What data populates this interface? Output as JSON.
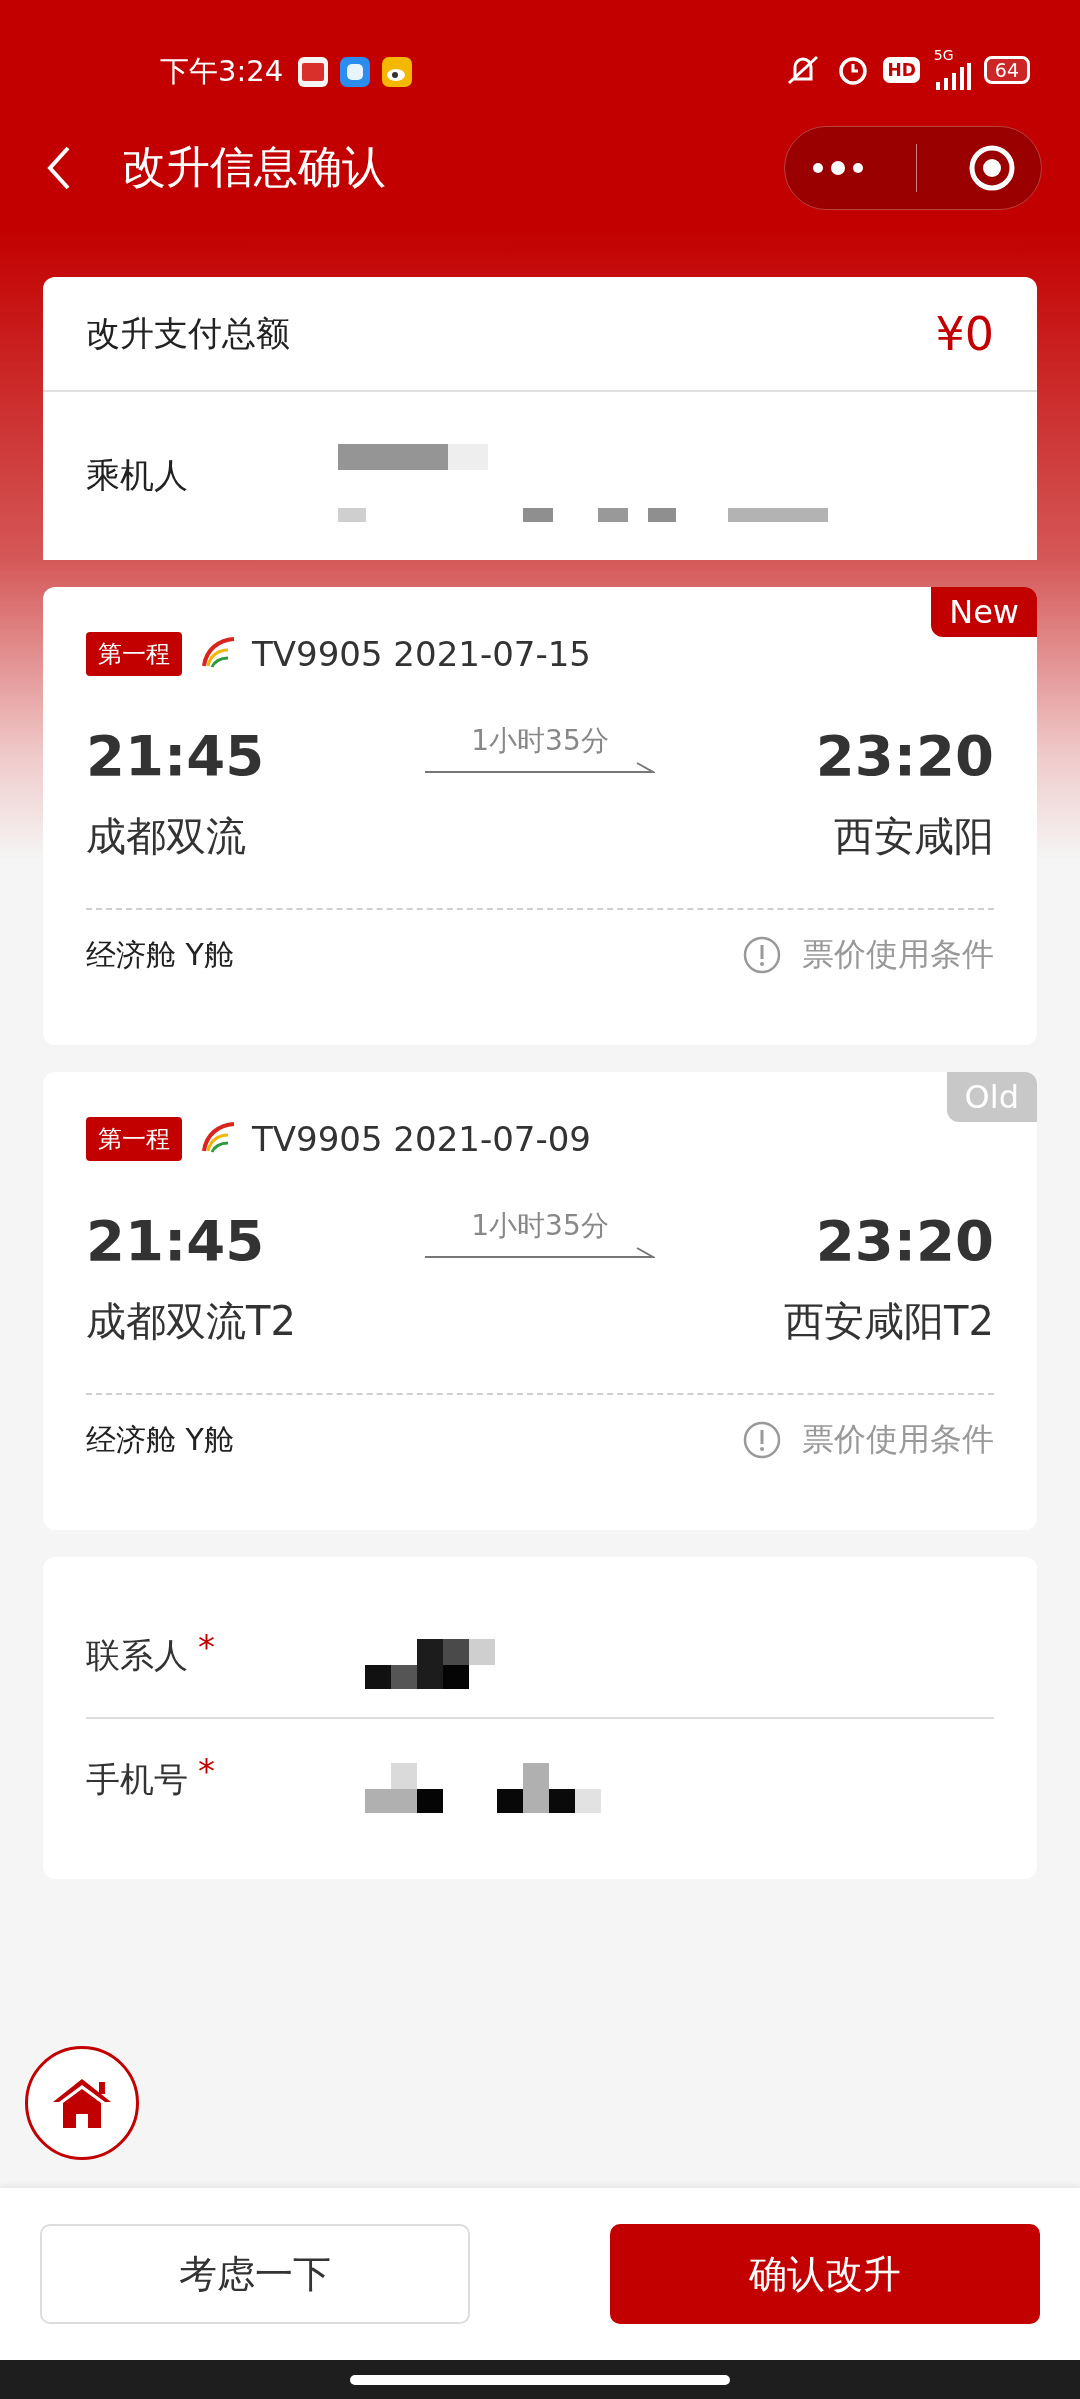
{
  "status_bar": {
    "time": "下午3:24",
    "hd": "HD",
    "network": "5G",
    "battery": "64"
  },
  "header": {
    "title": "改升信息确认"
  },
  "payment": {
    "label": "改升支付总额",
    "amount": "¥0"
  },
  "passenger": {
    "label": "乘机人"
  },
  "flights": [
    {
      "kind": "new",
      "tag": "New",
      "segment": "第一程",
      "flight": "TV9905 2021-07-15",
      "dep_time": "21:45",
      "duration": "1小时35分",
      "arr_time": "23:20",
      "dep_airport": "成都双流",
      "arr_airport": "西安咸阳",
      "cabin": "经济舱 Y舱",
      "rules": "票价使用条件"
    },
    {
      "kind": "old",
      "tag": "Old",
      "segment": "第一程",
      "flight": "TV9905 2021-07-09",
      "dep_time": "21:45",
      "duration": "1小时35分",
      "arr_time": "23:20",
      "dep_airport": "成都双流T2",
      "arr_airport": "西安咸阳T2",
      "cabin": "经济舱 Y舱",
      "rules": "票价使用条件"
    }
  ],
  "contact": [
    {
      "label": "联系人",
      "required": "*"
    },
    {
      "label": "手机号",
      "required": "*"
    }
  ],
  "buttons": [
    {
      "kind": "secondary",
      "label": "考虑一下"
    },
    {
      "kind": "primary",
      "label": "确认改升"
    }
  ]
}
